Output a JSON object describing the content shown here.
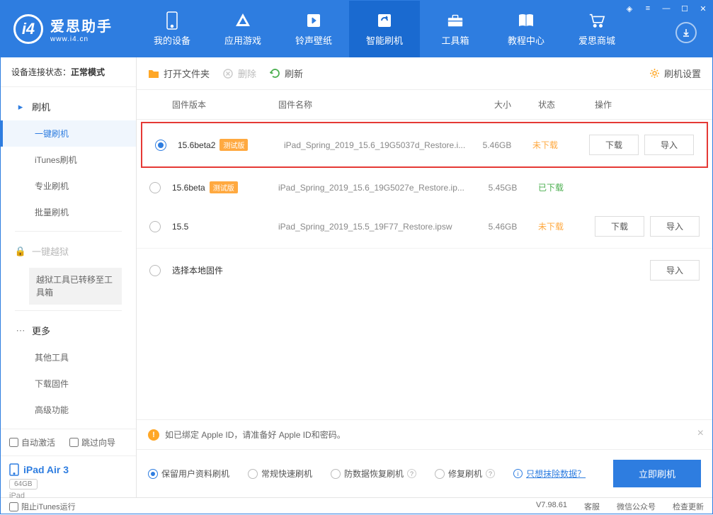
{
  "app": {
    "title": "爱思助手",
    "subtitle": "www.i4.cn"
  },
  "nav": [
    {
      "label": "我的设备"
    },
    {
      "label": "应用游戏"
    },
    {
      "label": "铃声壁纸"
    },
    {
      "label": "智能刷机"
    },
    {
      "label": "工具箱"
    },
    {
      "label": "教程中心"
    },
    {
      "label": "爱思商城"
    }
  ],
  "sidebar": {
    "conn_label": "设备连接状态：",
    "conn_value": "正常模式",
    "flash_title": "刷机",
    "items": [
      "一键刷机",
      "iTunes刷机",
      "专业刷机",
      "批量刷机"
    ],
    "jailbreak_title": "一键越狱",
    "jailbreak_note": "越狱工具已转移至工具箱",
    "more_title": "更多",
    "more_items": [
      "其他工具",
      "下载固件",
      "高级功能"
    ],
    "auto_activate": "自动激活",
    "skip_guide": "跳过向导",
    "device_name": "iPad Air 3",
    "device_cap": "64GB",
    "device_type": "iPad"
  },
  "toolbar": {
    "open": "打开文件夹",
    "delete": "删除",
    "refresh": "刷新",
    "settings": "刷机设置"
  },
  "table": {
    "h_version": "固件版本",
    "h_name": "固件名称",
    "h_size": "大小",
    "h_status": "状态",
    "h_ops": "操作"
  },
  "firmware": [
    {
      "version": "15.6beta2",
      "beta": "测试版",
      "name": "iPad_Spring_2019_15.6_19G5037d_Restore.i...",
      "size": "5.46GB",
      "status": "未下载",
      "status_class": "st-not",
      "selected": true,
      "ops": true
    },
    {
      "version": "15.6beta",
      "beta": "测试版",
      "name": "iPad_Spring_2019_15.6_19G5027e_Restore.ip...",
      "size": "5.45GB",
      "status": "已下载",
      "status_class": "st-done",
      "selected": false,
      "ops": false
    },
    {
      "version": "15.5",
      "beta": "",
      "name": "iPad_Spring_2019_15.5_19F77_Restore.ipsw",
      "size": "5.46GB",
      "status": "未下载",
      "status_class": "st-not",
      "selected": false,
      "ops": true
    }
  ],
  "local_fw": "选择本地固件",
  "ops_labels": {
    "download": "下载",
    "import": "导入"
  },
  "warning": "如已绑定 Apple ID，请准备好 Apple ID和密码。",
  "options": {
    "keep_data": "保留用户资料刷机",
    "fast": "常规快速刷机",
    "recovery": "防数据恢复刷机",
    "repair": "修复刷机",
    "erase_link": "只想抹除数据？",
    "flash_btn": "立即刷机"
  },
  "statusbar": {
    "block_itunes": "阻止iTunes运行",
    "version": "V7.98.61",
    "right": [
      "客服",
      "微信公众号",
      "检查更新"
    ]
  }
}
